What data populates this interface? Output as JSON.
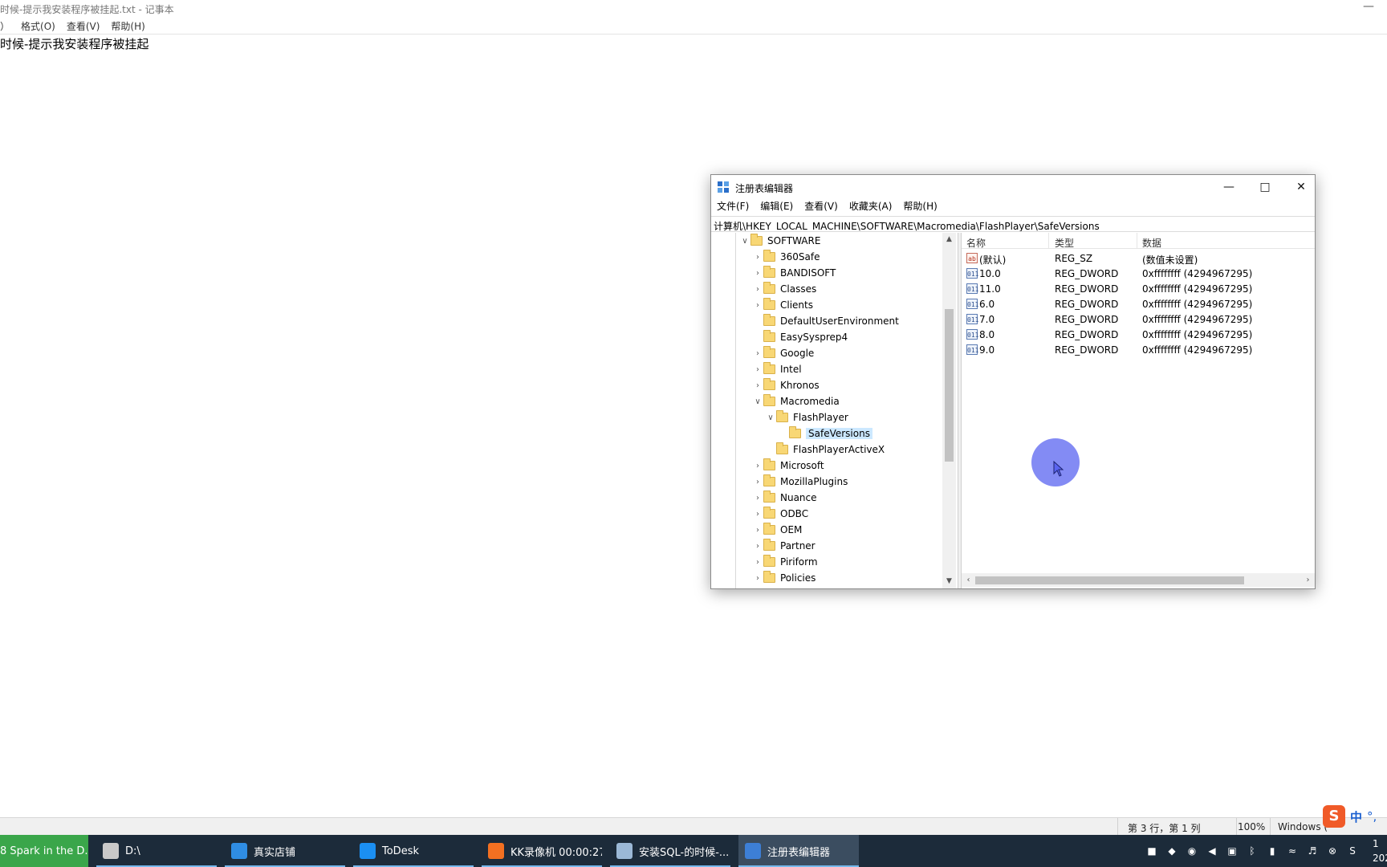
{
  "notepad": {
    "title": "时候-提示我安装程序被挂起.txt - 记事本",
    "menu": [
      "）",
      "格式(O)",
      "查看(V)",
      "帮助(H)"
    ],
    "content": "时候-提示我安装程序被挂起",
    "status": {
      "position": "第 3 行，第 1 列",
      "zoom": "100%",
      "eol": "Windows ("
    }
  },
  "regedit": {
    "title": "注册表编辑器",
    "menu": [
      "文件(F)",
      "编辑(E)",
      "查看(V)",
      "收藏夹(A)",
      "帮助(H)"
    ],
    "address": "计算机\\HKEY_LOCAL_MACHINE\\SOFTWARE\\Macromedia\\FlashPlayer\\SafeVersions",
    "tree": [
      {
        "label": "SOFTWARE",
        "level": 0,
        "expander": "expanded"
      },
      {
        "label": "360Safe",
        "level": 1,
        "expander": "collapsed"
      },
      {
        "label": "BANDISOFT",
        "level": 1,
        "expander": "collapsed"
      },
      {
        "label": "Classes",
        "level": 1,
        "expander": "collapsed"
      },
      {
        "label": "Clients",
        "level": 1,
        "expander": "collapsed"
      },
      {
        "label": "DefaultUserEnvironment",
        "level": 1,
        "expander": "none"
      },
      {
        "label": "EasySysprep4",
        "level": 1,
        "expander": "none"
      },
      {
        "label": "Google",
        "level": 1,
        "expander": "collapsed"
      },
      {
        "label": "Intel",
        "level": 1,
        "expander": "collapsed"
      },
      {
        "label": "Khronos",
        "level": 1,
        "expander": "collapsed"
      },
      {
        "label": "Macromedia",
        "level": 1,
        "expander": "expanded"
      },
      {
        "label": "FlashPlayer",
        "level": 2,
        "expander": "expanded"
      },
      {
        "label": "SafeVersions",
        "level": 3,
        "expander": "none",
        "selected": true
      },
      {
        "label": "FlashPlayerActiveX",
        "level": 2,
        "expander": "none"
      },
      {
        "label": "Microsoft",
        "level": 1,
        "expander": "collapsed"
      },
      {
        "label": "MozillaPlugins",
        "level": 1,
        "expander": "collapsed"
      },
      {
        "label": "Nuance",
        "level": 1,
        "expander": "collapsed"
      },
      {
        "label": "ODBC",
        "level": 1,
        "expander": "collapsed"
      },
      {
        "label": "OEM",
        "level": 1,
        "expander": "collapsed"
      },
      {
        "label": "Partner",
        "level": 1,
        "expander": "collapsed"
      },
      {
        "label": "Piriform",
        "level": 1,
        "expander": "collapsed"
      },
      {
        "label": "Policies",
        "level": 1,
        "expander": "collapsed"
      }
    ],
    "columns": [
      "名称",
      "类型",
      "数据"
    ],
    "values": [
      {
        "name": "(默认)",
        "type": "REG_SZ",
        "data": "(数值未设置)",
        "icon": "ab"
      },
      {
        "name": "10.0",
        "type": "REG_DWORD",
        "data": "0xffffffff (4294967295)",
        "icon": "011"
      },
      {
        "name": "11.0",
        "type": "REG_DWORD",
        "data": "0xffffffff (4294967295)",
        "icon": "011"
      },
      {
        "name": "6.0",
        "type": "REG_DWORD",
        "data": "0xffffffff (4294967295)",
        "icon": "011"
      },
      {
        "name": "7.0",
        "type": "REG_DWORD",
        "data": "0xffffffff (4294967295)",
        "icon": "011"
      },
      {
        "name": "8.0",
        "type": "REG_DWORD",
        "data": "0xffffffff (4294967295)",
        "icon": "011"
      },
      {
        "name": "9.0",
        "type": "REG_DWORD",
        "data": "0xffffffff (4294967295)",
        "icon": "011"
      }
    ]
  },
  "taskbar": {
    "items": [
      {
        "label": "8 Spark in the D...",
        "color": "#3aa64a",
        "active": false,
        "name": "spark"
      },
      {
        "label": "D:\\",
        "color": "#c9c9c9",
        "active": false,
        "name": "drive-d"
      },
      {
        "label": "真实店铺",
        "color": "#2f8de4",
        "active": false,
        "name": "store"
      },
      {
        "label": "ToDesk",
        "color": "#1b8ff2",
        "active": false,
        "name": "todesk"
      },
      {
        "label": "KK录像机 00:00:27",
        "color": "#f37021",
        "active": false,
        "name": "kk-recorder"
      },
      {
        "label": "安装SQL-的时候-...",
        "color": "#9bb8d6",
        "active": false,
        "name": "notepad-task"
      },
      {
        "label": "注册表编辑器",
        "color": "#3d7fd6",
        "active": true,
        "name": "regedit-task"
      }
    ],
    "ime": {
      "s": "S",
      "lang": "中",
      "mode": "°,"
    },
    "clock": {
      "time": "1",
      "date": "202"
    }
  }
}
